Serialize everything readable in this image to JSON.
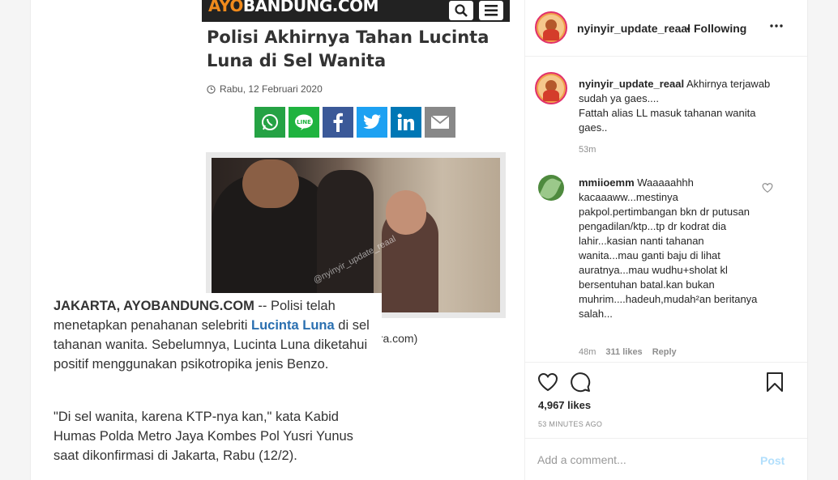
{
  "post_image": {
    "site_logo_a": "AYO",
    "site_logo_b": "BANDUNG.COM",
    "headline": "Polisi Akhirnya Tahan Lucinta Luna di Sel Wanita",
    "date": "Rabu, 12 Februari 2020",
    "share_buttons": [
      {
        "name": "whatsapp",
        "color": "#25a244"
      },
      {
        "name": "line",
        "color": "#1fb33f"
      },
      {
        "name": "facebook",
        "color": "#3b5998"
      },
      {
        "name": "twitter",
        "color": "#1da1f2"
      },
      {
        "name": "linkedin",
        "color": "#0077b5"
      },
      {
        "name": "email",
        "color": "#888888"
      }
    ],
    "caption_tail": "ara.com)",
    "paragraph_1_dateline": "JAKARTA, AYOBANDUNG.COM",
    "paragraph_1_a": " -- Polisi telah menetapkan penahanan selebriti ",
    "paragraph_1_link": "Lucinta Luna",
    "paragraph_1_b": " di sel tahanan wanita. Sebelumnya, Lucinta Luna diketahui positif menggunakan psikotropika jenis Benzo.",
    "paragraph_2": "\"Di sel wanita, karena KTP-nya kan,\" kata Kabid Humas Polda Metro Jaya Kombes Pol Yusri Yunus saat dikonfirmasi di Jakarta, Rabu (12/2).",
    "watermark": "@nyinyir_update_reaal"
  },
  "instagram": {
    "username": "nyinyir_update_reaal",
    "separator": "•",
    "follow_status": "Following",
    "caption_user": "nyinyir_update_reaal",
    "caption_text": " Akhirnya terjawab sudah ya gaes....\nFattah alias LL masuk tahanan wanita gaes..",
    "caption_time": "53m",
    "comment_user": "mmiioemm",
    "comment_text": " Waaaaahhh kacaaaww...mestinya pakpol.pertimbangan bkn dr putusan pengadilan/ktp...tp dr kodrat dia lahir...kasian nanti tahanan wanita...mau ganti baju di lihat auratnya...mau wudhu+sholat kl bersentuhan batal.kan bukan muhrim....hadeuh,mudah²an beritanya salah...",
    "comment_time": "48m",
    "comment_likes": "311 likes",
    "comment_reply": "Reply",
    "likes": "4,967 likes",
    "post_time": "53 MINUTES AGO",
    "add_comment_placeholder": "Add a comment...",
    "post_button": "Post"
  }
}
